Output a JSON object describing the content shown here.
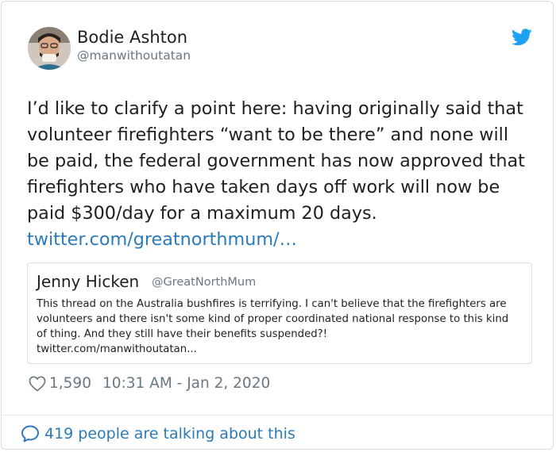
{
  "author": {
    "name": "Bodie Ashton",
    "handle": "@manwithoutatan"
  },
  "tweet": {
    "text": "I’d like to clarify a point here: having originally said that volunteer firefighters “want to be there” and none will be paid, the federal government has now approved that firefighters who have taken days off work will now be paid $300/day for a maximum 20 days. ",
    "link": "twitter.com/greatnorthmum/…"
  },
  "quoted": {
    "name": "Jenny Hicken",
    "handle": "@GreatNorthMum",
    "text": "This thread on the Australia bushfires is terrifying. I can't believe that the firefighters are volunteers and there isn't some kind of proper coordinated national response to this kind of thing. And they still have their benefits suspended?!",
    "link": "twitter.com/manwithoutatan..."
  },
  "meta": {
    "likes": "1,590",
    "timestamp": "10:31 AM - Jan 2, 2020"
  },
  "footer": {
    "talking": "419 people are talking about this"
  },
  "colors": {
    "link": "#2b7bb9",
    "twitter_blue": "#1da1f2",
    "secondary_text": "#697882"
  },
  "icons": [
    "twitter-bird-icon",
    "heart-icon",
    "speech-bubble-icon"
  ]
}
